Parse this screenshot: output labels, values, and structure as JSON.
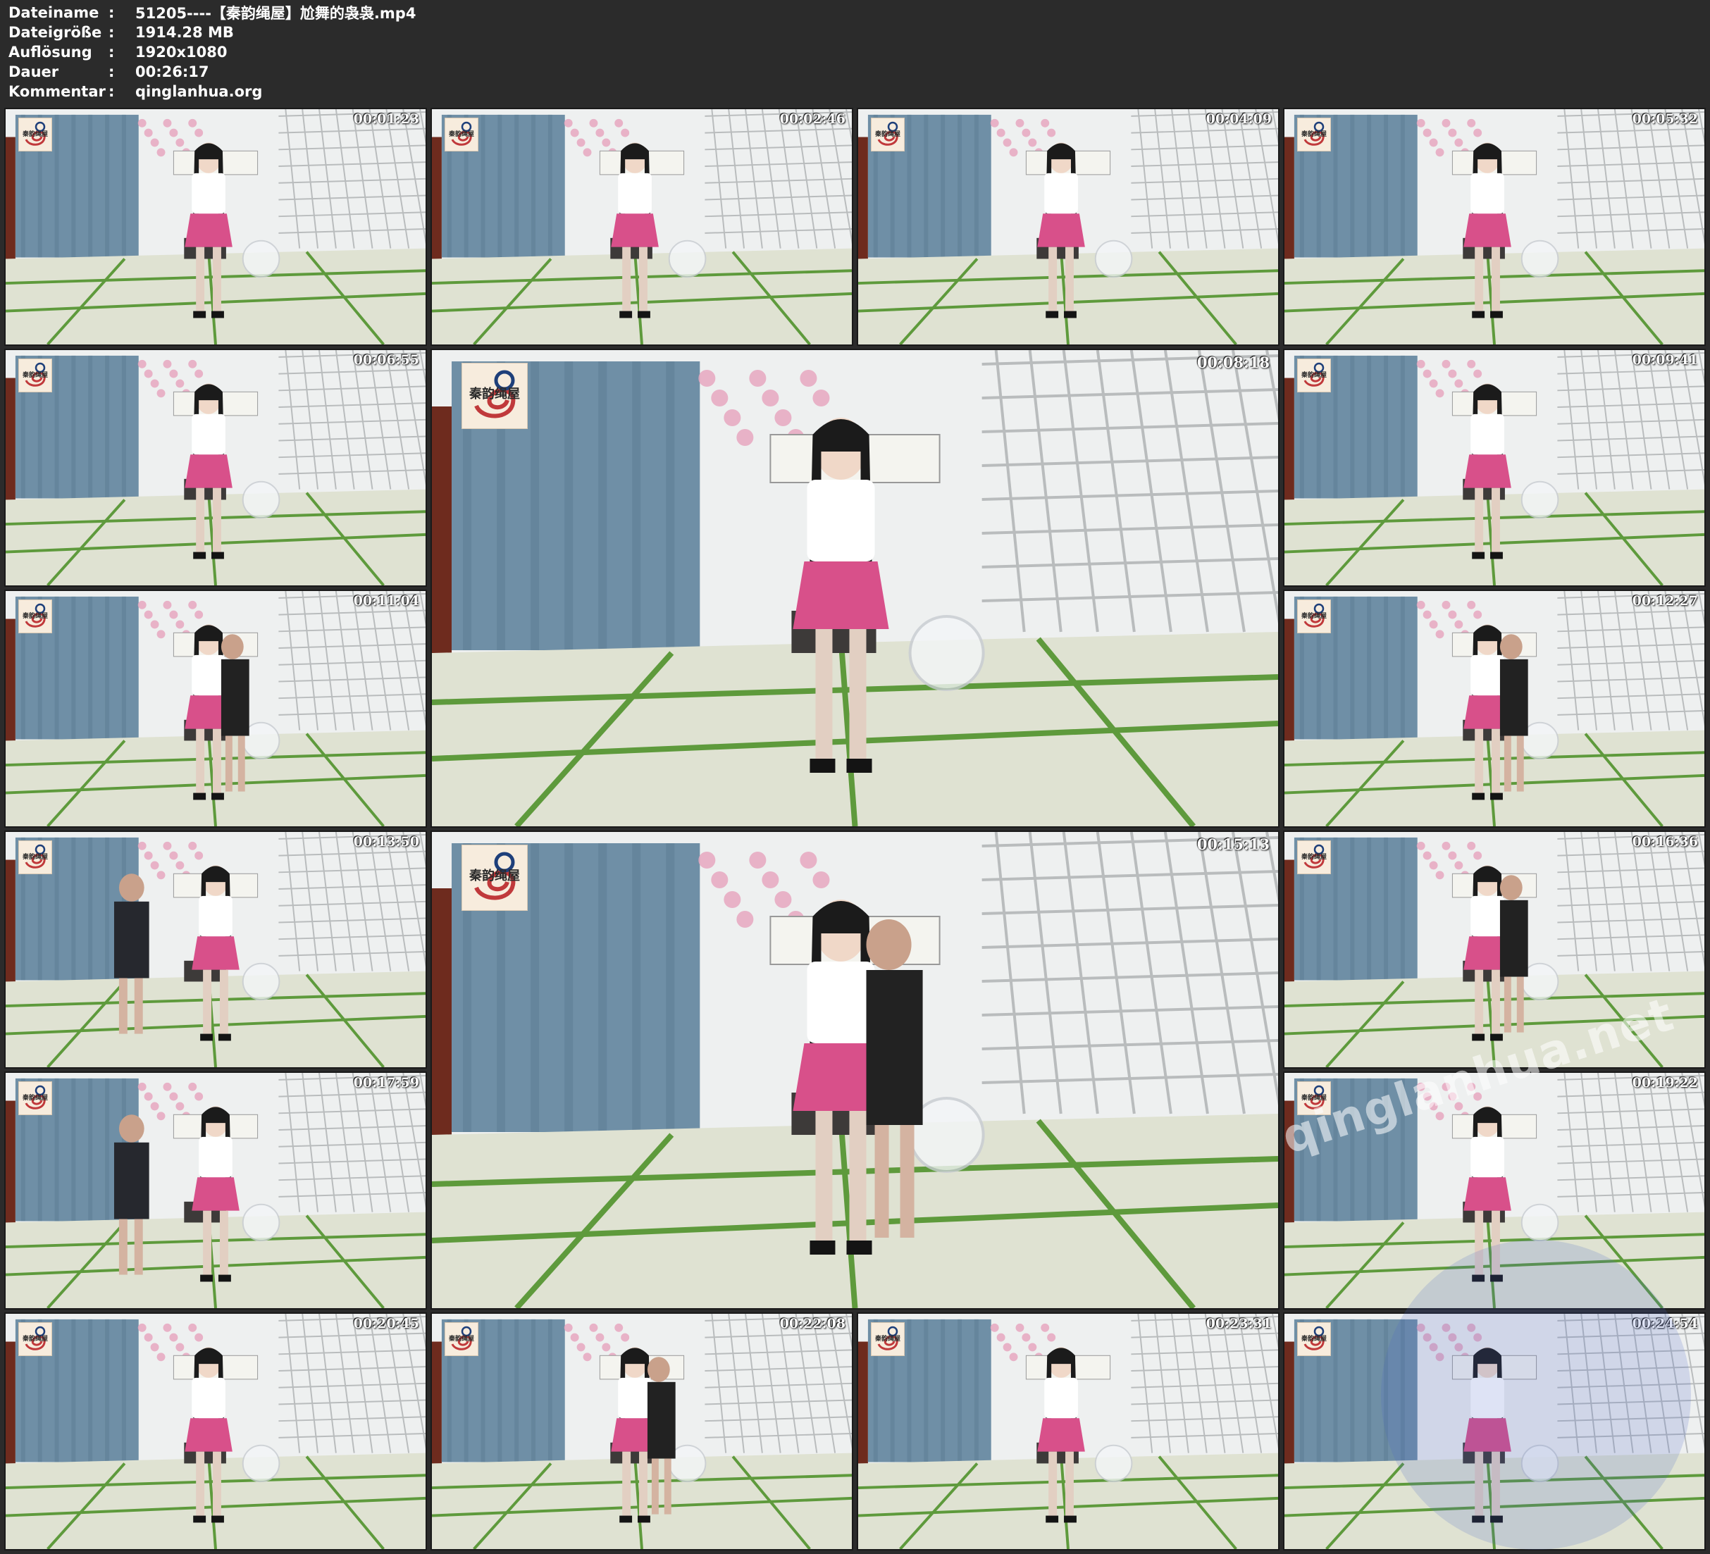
{
  "meta": [
    {
      "label": "Dateiname",
      "sep": ":",
      "value": "51205----【秦韵绳屋】尬舞的袅袅.mp4"
    },
    {
      "label": "Dateigröße",
      "sep": ":",
      "value": "1914.28 MB"
    },
    {
      "label": "Auflösung",
      "sep": ":",
      "value": "1920x1080"
    },
    {
      "label": "Dauer",
      "sep": ":",
      "value": "00:26:17"
    },
    {
      "label": "Kommentar",
      "sep": ":",
      "value": "qinglanhua.org"
    }
  ],
  "logo_text": "秦韵绳屋",
  "watermark": "qinglanhua.net",
  "thumbnails": [
    {
      "time": "00:01:23",
      "size": "small",
      "person2": "none"
    },
    {
      "time": "00:02:46",
      "size": "small",
      "person2": "none"
    },
    {
      "time": "00:04:09",
      "size": "small",
      "person2": "none"
    },
    {
      "time": "00:05:32",
      "size": "small",
      "person2": "none"
    },
    {
      "time": "00:06:55",
      "size": "small",
      "person2": "none"
    },
    {
      "time": "00:08:18",
      "size": "big",
      "person2": "none"
    },
    {
      "time": "00:09:41",
      "size": "small",
      "person2": "none"
    },
    {
      "time": "00:11:04",
      "size": "small",
      "person2": "behind"
    },
    {
      "time": "00:12:27",
      "size": "small",
      "person2": "behind"
    },
    {
      "time": "00:13:50",
      "size": "small",
      "person2": "left"
    },
    {
      "time": "00:15:13",
      "size": "big",
      "person2": "behind"
    },
    {
      "time": "00:16:36",
      "size": "small",
      "person2": "behind"
    },
    {
      "time": "00:17:59",
      "size": "small",
      "person2": "left"
    },
    {
      "time": "00:19:22",
      "size": "small",
      "person2": "none"
    },
    {
      "time": "00:20:45",
      "size": "small",
      "person2": "none"
    },
    {
      "time": "00:22:08",
      "size": "small",
      "person2": "behind"
    },
    {
      "time": "00:23:31",
      "size": "small",
      "person2": "none"
    },
    {
      "time": "00:24:54",
      "size": "small",
      "person2": "none"
    }
  ],
  "colors": {
    "background": "#2b2b2b",
    "curtain": "#6f8fa6",
    "wall": "#eef0f0",
    "floor": "#dfe2d2",
    "tatami_line": "#5e9a3c",
    "skirt": "#d8508a",
    "shirt": "#ffffff"
  }
}
